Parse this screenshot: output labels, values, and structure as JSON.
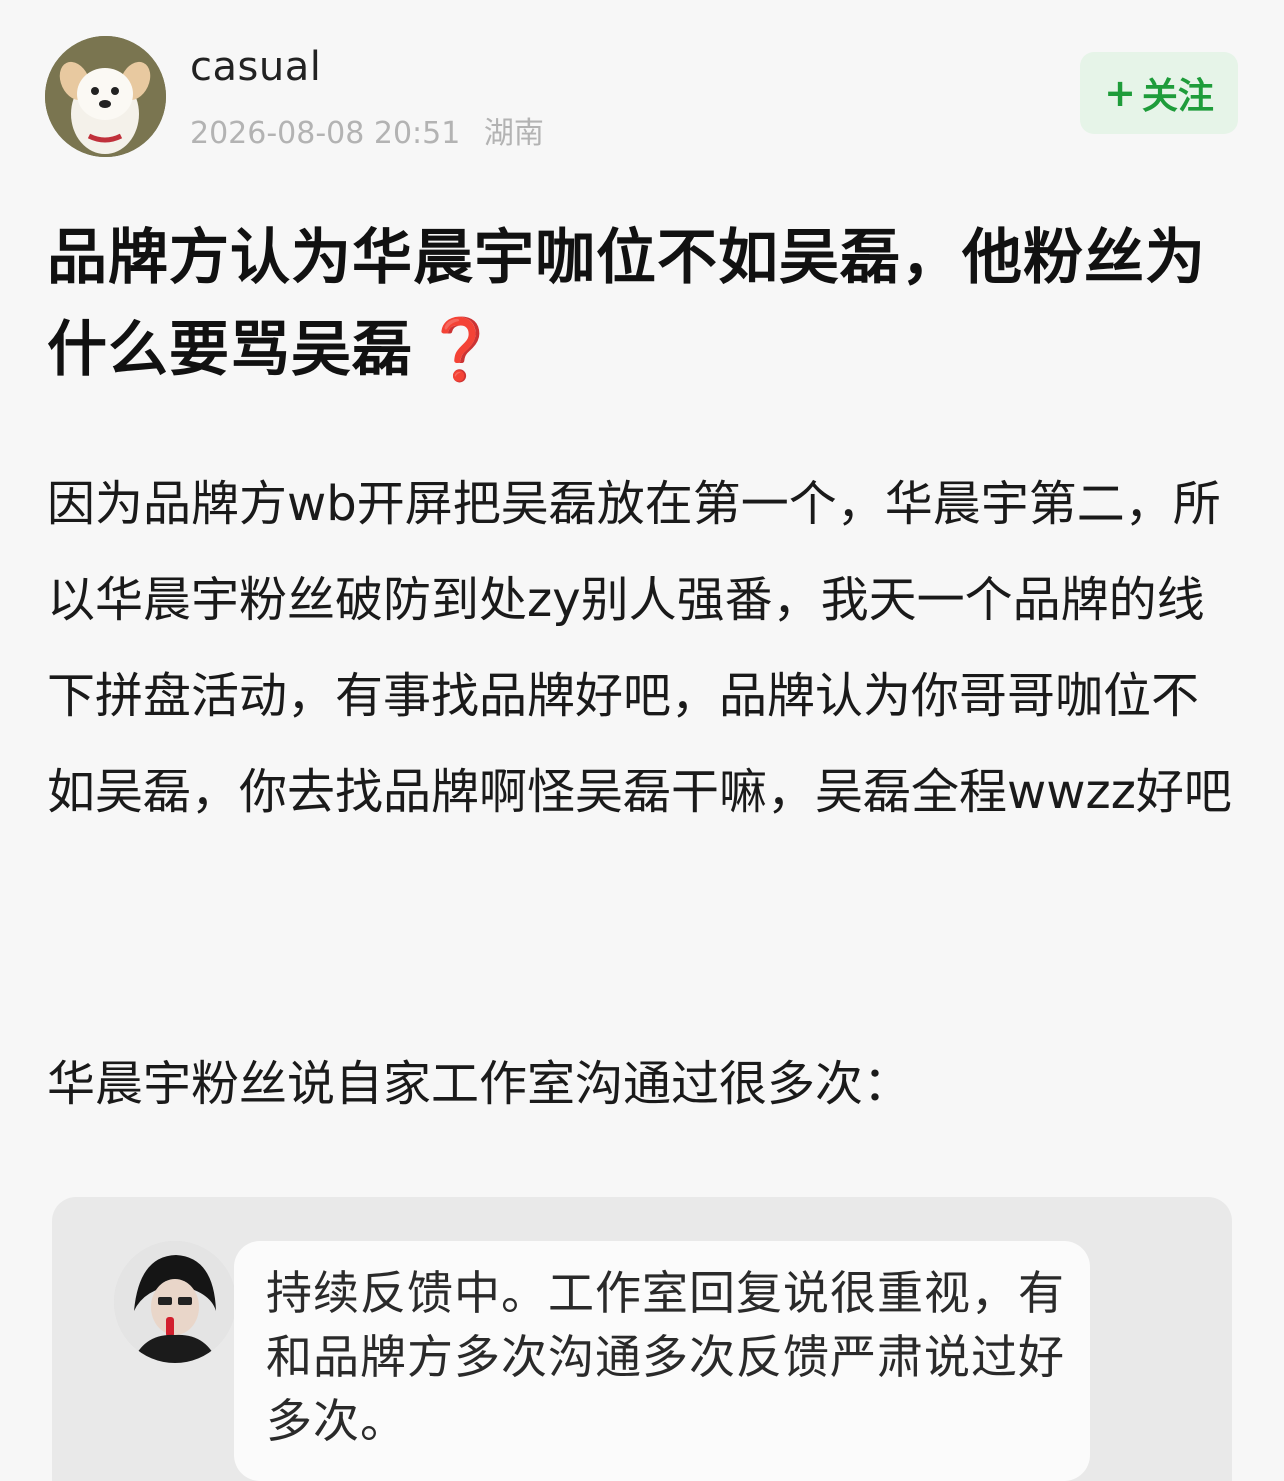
{
  "post": {
    "author": {
      "name": "casual",
      "avatar": "dog-avatar"
    },
    "timestamp": "2026-08-08 20:51",
    "location": "湖南",
    "follow_label": "关注",
    "follow_icon": "plus-icon",
    "title": "品牌方认为华晨宇咖位不如吴磊，他粉丝为什么要骂吴磊",
    "title_emoji": "❓",
    "body_paragraph_1": "因为品牌方wb开屏把吴磊放在第一个，华晨宇第二，所以华晨宇粉丝破防到处zy别人强番，我天一个品牌的线下拼盘活动，有事找品牌好吧，品牌认为你哥哥咖位不如吴磊，你去找品牌啊怪吴磊干嘛，吴磊全程wwzz好吧",
    "body_paragraph_2": "华晨宇粉丝说自家工作室沟通过很多次："
  },
  "quoted_screenshot": {
    "avatar": "singer-avatar",
    "message": "持续反馈中。工作室回复说很重视，有和品牌方多次沟通多次反馈严肃说过好多次。"
  },
  "colors": {
    "accent_green": "#1e9c3a",
    "follow_bg": "#e6f4e8",
    "question_red": "#d6262f"
  }
}
